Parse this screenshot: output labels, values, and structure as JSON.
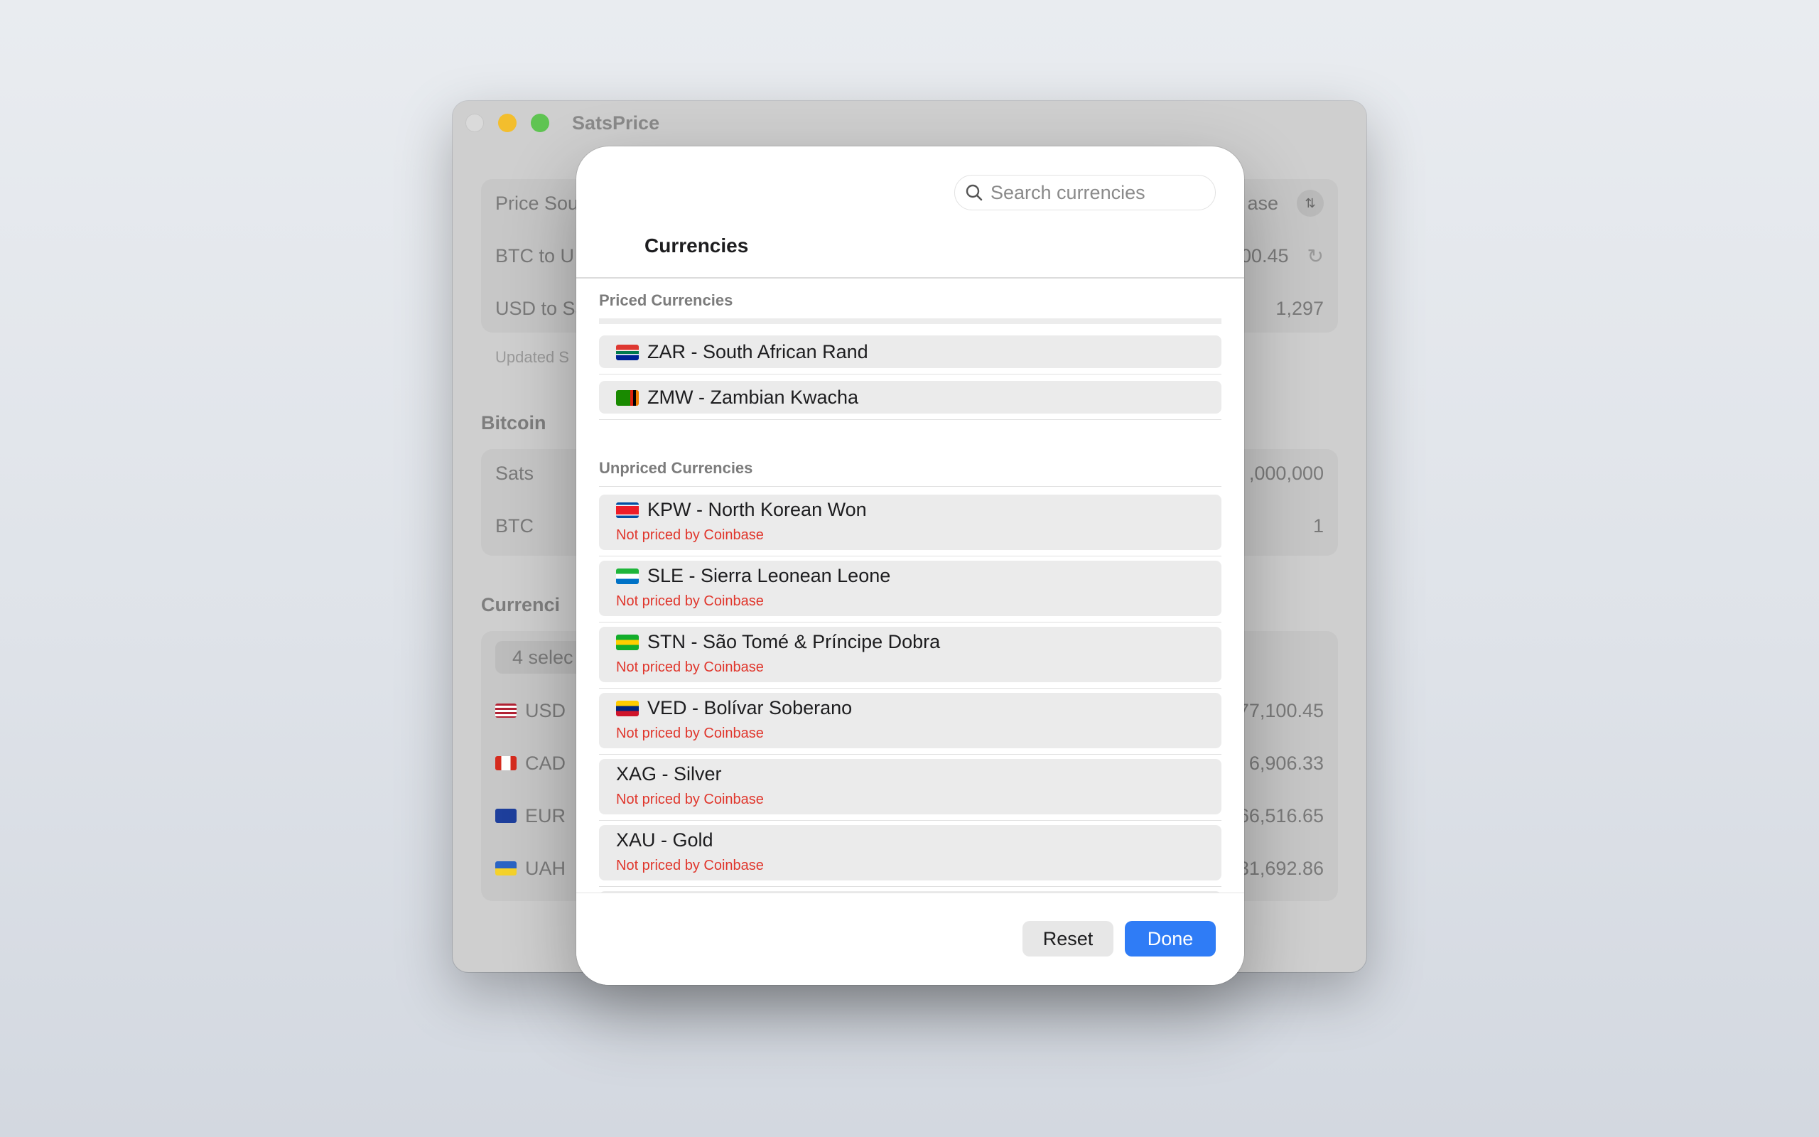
{
  "window": {
    "title": "SatsPrice",
    "background": {
      "price_source_label": "Price Sou",
      "price_source_value": "ase",
      "btc_to_usd_label": "BTC to U",
      "btc_to_usd_value": "00.45",
      "usd_to_sats_label": "USD to Sa",
      "usd_to_sats_value": "1,297",
      "updated_text": "Updated S",
      "bitcoin_header": "Bitcoin",
      "sats_label": "Sats",
      "sats_value": ",000,000",
      "btc_label": "BTC",
      "btc_value": "1",
      "currencies_header": "Currenci",
      "selected_chip": "4 selec",
      "rows": [
        {
          "code": "USD",
          "value": "77,100.45"
        },
        {
          "code": "CAD",
          "value": "6,906.33"
        },
        {
          "code": "EUR",
          "value": "66,516.65"
        },
        {
          "code": "UAH",
          "value": "31,692.86"
        }
      ]
    }
  },
  "sheet": {
    "search_placeholder": "Search currencies",
    "title": "Currencies",
    "priced_section": "Priced Currencies",
    "priced": [
      {
        "label": "ZAR - South African Rand"
      },
      {
        "label": "ZMW - Zambian Kwacha"
      }
    ],
    "unpriced_section": "Unpriced Currencies",
    "unpriced": [
      {
        "label": "KPW - North Korean Won",
        "note": "Not priced by Coinbase"
      },
      {
        "label": "SLE - Sierra Leonean Leone",
        "note": "Not priced by Coinbase"
      },
      {
        "label": "STN - São Tomé & Príncipe Dobra",
        "note": "Not priced by Coinbase"
      },
      {
        "label": "VED - Bolívar Soberano",
        "note": "Not priced by Coinbase"
      },
      {
        "label": "XAG - Silver",
        "note": "Not priced by Coinbase"
      },
      {
        "label": "XAU - Gold",
        "note": "Not priced by Coinbase"
      }
    ],
    "reset_label": "Reset",
    "done_label": "Done"
  },
  "colors": {
    "accent": "#2f7cf6",
    "warning_text": "#e0362c"
  }
}
